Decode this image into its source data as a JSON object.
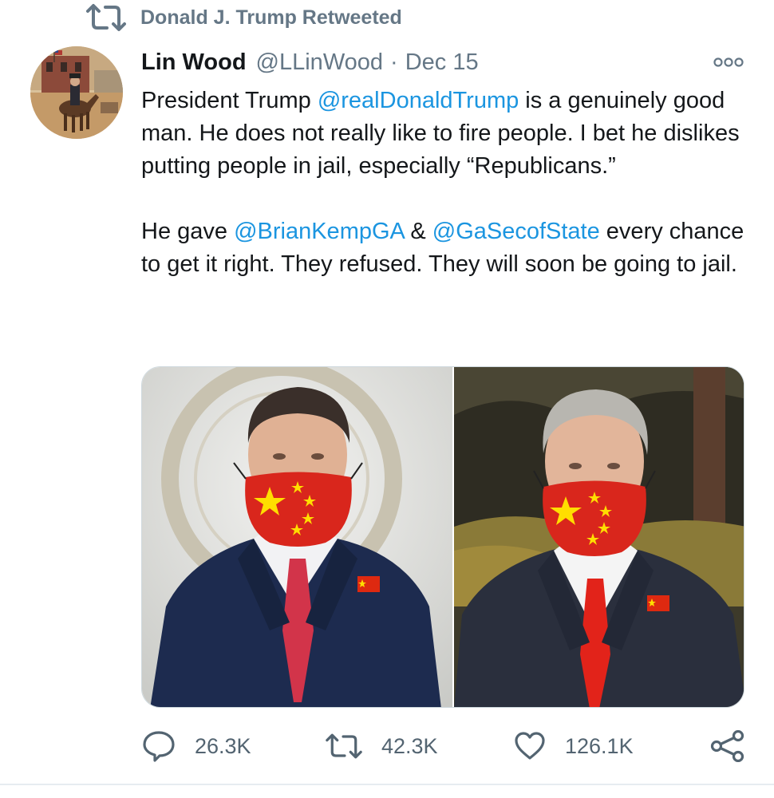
{
  "retweet": {
    "label": "Donald J. Trump Retweeted",
    "icon": "retweet-icon"
  },
  "tweet": {
    "author_name": "Lin Wood",
    "author_handle": "@LLinWood",
    "separator": "·",
    "date": "Dec 15",
    "more_icon": "more-options-icon",
    "text": {
      "p1_part1": "President Trump ",
      "p1_mention1": "@realDonaldTrump",
      "p1_part2": " is a genuinely good man. He does not really like to fire people. I bet he dislikes putting people in jail, especially “Republicans.”",
      "p2_part1": "He gave ",
      "p2_mention1": "@BrianKempGA",
      "p2_part2": " & ",
      "p2_mention2": "@GaSecofState",
      "p2_part3": " every chance to get it right. They refused. They will soon be going to jail."
    },
    "media": {
      "left_photo": "photo-man-with-china-flag-mask-left",
      "right_photo": "photo-man-with-china-flag-mask-right"
    },
    "actions": {
      "replies": "26.3K",
      "retweets": "42.3K",
      "likes": "126.1K",
      "reply_icon": "reply-icon",
      "retweet_icon": "retweet-icon",
      "like_icon": "heart-icon",
      "share_icon": "share-icon"
    }
  },
  "colors": {
    "link": "#1b95e0",
    "secondary_text": "#657786",
    "primary_text": "#14171a",
    "mask_red": "#d9261c",
    "star_yellow": "#ffde00"
  }
}
